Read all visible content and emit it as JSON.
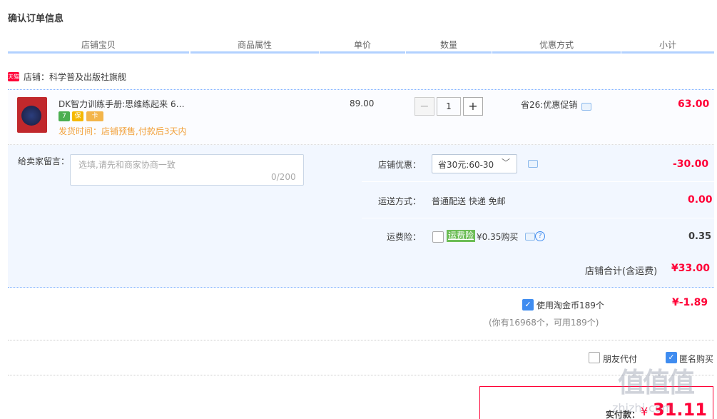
{
  "page_title": "确认订单信息",
  "columns": [
    "店铺宝贝",
    "商品属性",
    "单价",
    "数量",
    "优惠方式",
    "小计"
  ],
  "shop": {
    "badge": "天猫",
    "label": "店铺：科学普及出版社旗舰"
  },
  "item": {
    "name": "DK智力训练手册:思维练起来 6…",
    "shipping": "发货时间：店铺预售,付款后3天内",
    "price": "89.00",
    "quantity": "1",
    "promo": "省26:优惠促销",
    "subtotal": "63.00",
    "badges": [
      "7",
      "保",
      "卡"
    ]
  },
  "memo": {
    "label": "给卖家留言：",
    "placeholder": "选填,请先和商家协商一致",
    "count": "0/200"
  },
  "shop_coupon": {
    "label": "店铺优惠：",
    "selected": "省30元:60-30",
    "amount": "-30.00"
  },
  "delivery": {
    "label": "运送方式：",
    "value": "普通配送 快递 免邮",
    "amount": "0.00"
  },
  "insurance": {
    "label": "运费险：",
    "tag": "运费险",
    "value": "¥0.35购买",
    "amount": "0.35",
    "checked": false
  },
  "shop_total": {
    "label": "店铺合计(含运费)",
    "value": "¥33.00"
  },
  "coins": {
    "label": "使用淘金币189个",
    "note": "(你有16968个，可用189个)",
    "amount": "¥-1.89",
    "checked": true
  },
  "options": {
    "friend_pay": "朋友代付",
    "anonymous": "匿名购买",
    "friend_checked": false,
    "anonymous_checked": true
  },
  "pay": {
    "label": "实付款：",
    "currency": "¥",
    "amount": "31.11"
  },
  "watermark": "值值值",
  "watermark_url": "zhizhi.com",
  "colors": {
    "accent_red": "#ff0036",
    "link_blue": "#3f8cf0",
    "shipping_orange": "#f2a23d"
  }
}
